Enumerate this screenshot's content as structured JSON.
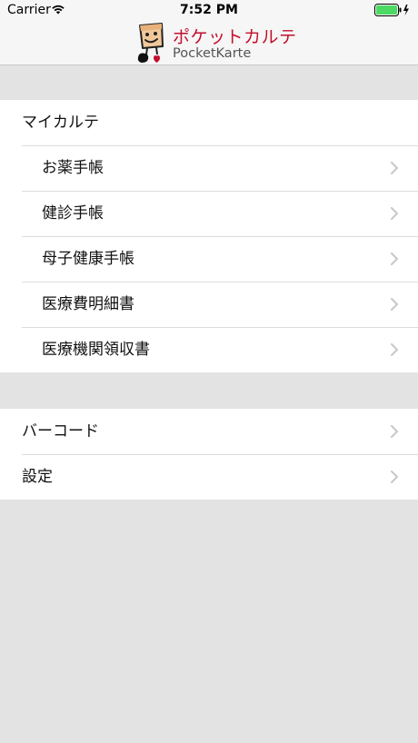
{
  "status_bar": {
    "carrier": "Carrier",
    "time": "7:52 PM",
    "wifi_icon": "wifi-icon",
    "battery_icon": "battery-full-charging-icon",
    "battery_color": "#4cd964"
  },
  "header": {
    "title": "ポケットカルテ",
    "subtitle": "PocketKarte",
    "title_color": "#c2102d",
    "logo_icon": "pocketkarte-mascot-logo"
  },
  "my_karte": {
    "heading": "マイカルテ",
    "items": [
      {
        "label": "お薬手帳"
      },
      {
        "label": "健診手帳"
      },
      {
        "label": "母子健康手帳"
      },
      {
        "label": "医療費明細書"
      },
      {
        "label": "医療機関領収書"
      }
    ]
  },
  "other": {
    "items": [
      {
        "label": "バーコード"
      },
      {
        "label": "設定"
      }
    ]
  },
  "chevron_icon": "chevron-right-icon"
}
